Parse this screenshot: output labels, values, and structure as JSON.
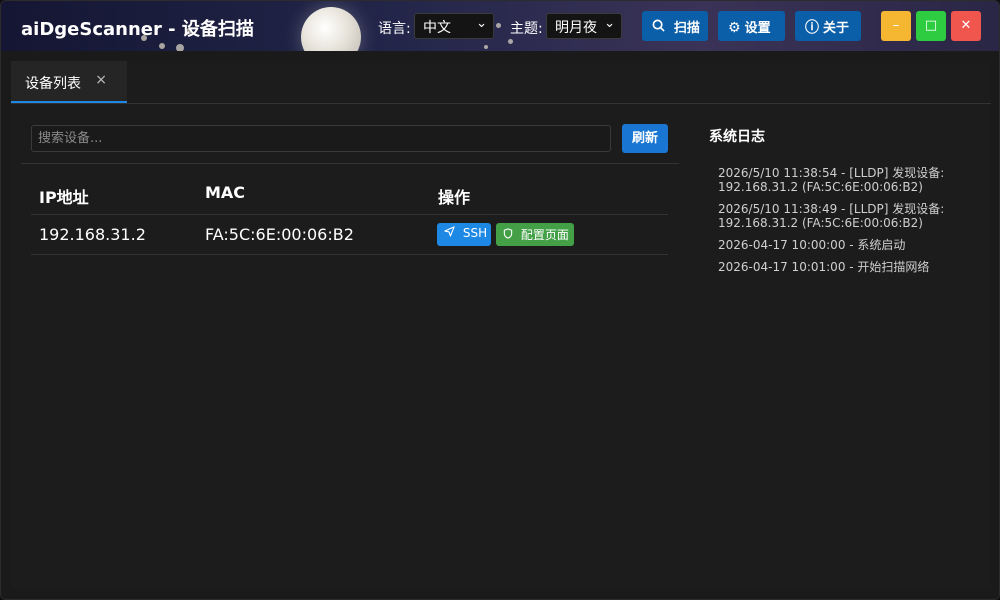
{
  "header": {
    "title": "aiDgeScanner - 设备扫描",
    "language_label": "语言:",
    "language_value": "中文",
    "theme_label": "主题:",
    "theme_value": "明月夜",
    "scan_label": "扫描",
    "settings_label": "设置",
    "about_label": "关于",
    "minimize_glyph": "–",
    "maximize_glyph": "□",
    "close_glyph": "✕",
    "colors": {
      "minimize": "#f5b731",
      "maximize": "#2ecc40",
      "close": "#f0554e",
      "header_button": "#0b5ea8"
    }
  },
  "tabs": [
    {
      "label": "设备列表",
      "close_glyph": "×",
      "active": true
    }
  ],
  "devices": {
    "search_placeholder": "搜索设备...",
    "refresh_label": "刷新",
    "columns": [
      "IP地址",
      "MAC",
      "操作"
    ],
    "rows": [
      {
        "ip": "192.168.31.2",
        "mac": "FA:5C:6E:00:06:B2",
        "actions": {
          "ssh_label": "SSH",
          "config_label": "配置页面"
        }
      }
    ],
    "colors": {
      "ssh": "#1e88e5",
      "config": "#43a047",
      "refresh": "#1976d2"
    }
  },
  "log": {
    "title": "系统日志",
    "entries": [
      "2026/5/10 11:38:54 - [LLDP] 发现设备: 192.168.31.2 (FA:5C:6E:00:06:B2)",
      "2026/5/10 11:38:49 - [LLDP] 发现设备: 192.168.31.2 (FA:5C:6E:00:06:B2)",
      "2026-04-17 10:00:00 - 系统启动",
      "2026-04-17 10:01:00 - 开始扫描网络"
    ]
  }
}
